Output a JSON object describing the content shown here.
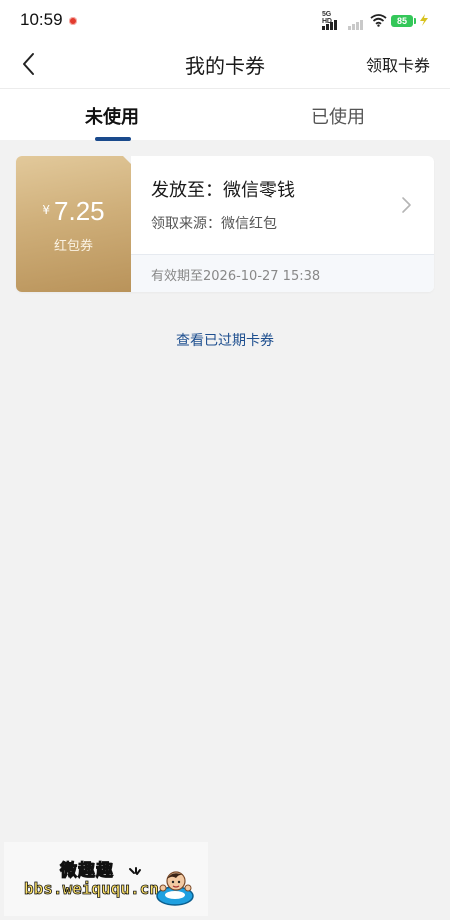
{
  "status_bar": {
    "time": "10:59",
    "network_label": "5G HD",
    "battery": "85",
    "icons": [
      "notification-dot",
      "signal-bars",
      "signal-bars-weak",
      "wifi-icon",
      "battery-icon",
      "charging-icon"
    ]
  },
  "nav": {
    "title": "我的卡券",
    "action_label": "领取卡券",
    "back_icon": "chevron-left-icon"
  },
  "tabs": [
    {
      "label": "未使用",
      "active": true
    },
    {
      "label": "已使用",
      "active": false
    }
  ],
  "coupon": {
    "currency_symbol": "¥",
    "amount": "7.25",
    "type": "红包券",
    "title": "发放至：微信零钱",
    "source": "领取来源：微信红包",
    "expiry": "有效期至2026-10-27 15:38",
    "accent_color": "#c8a46c"
  },
  "expired_link": "查看已过期卡券",
  "watermark": {
    "title": "微趣趣",
    "url": "bbs.weiququ.cn"
  },
  "colors": {
    "tab_indicator": "#1a4a8c",
    "link": "#1e4f8f",
    "background": "#f2f2f2"
  }
}
